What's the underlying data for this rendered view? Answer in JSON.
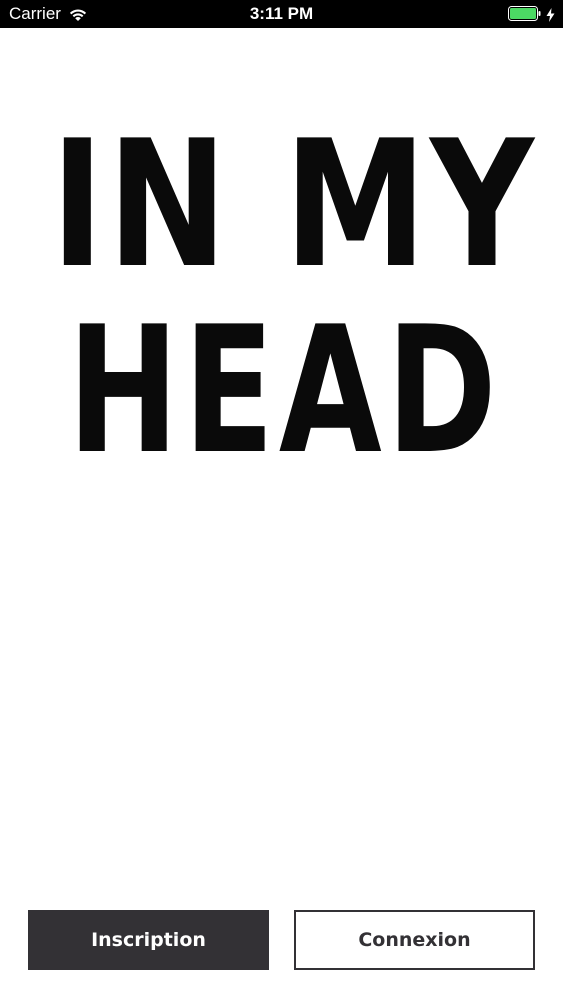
{
  "status_bar": {
    "carrier": "Carrier",
    "time": "3:11 PM",
    "icons": [
      "wifi-icon",
      "battery-icon",
      "charging-bolt-icon"
    ],
    "battery_color": "#4cd964"
  },
  "logo": {
    "line1": "IN MY",
    "line2": "HEAD"
  },
  "actions": {
    "inscription_label": "Inscription",
    "connexion_label": "Connexion"
  },
  "colors": {
    "background": "#ffffff",
    "primary_button": "#333135",
    "text": "#0a0a0a"
  }
}
